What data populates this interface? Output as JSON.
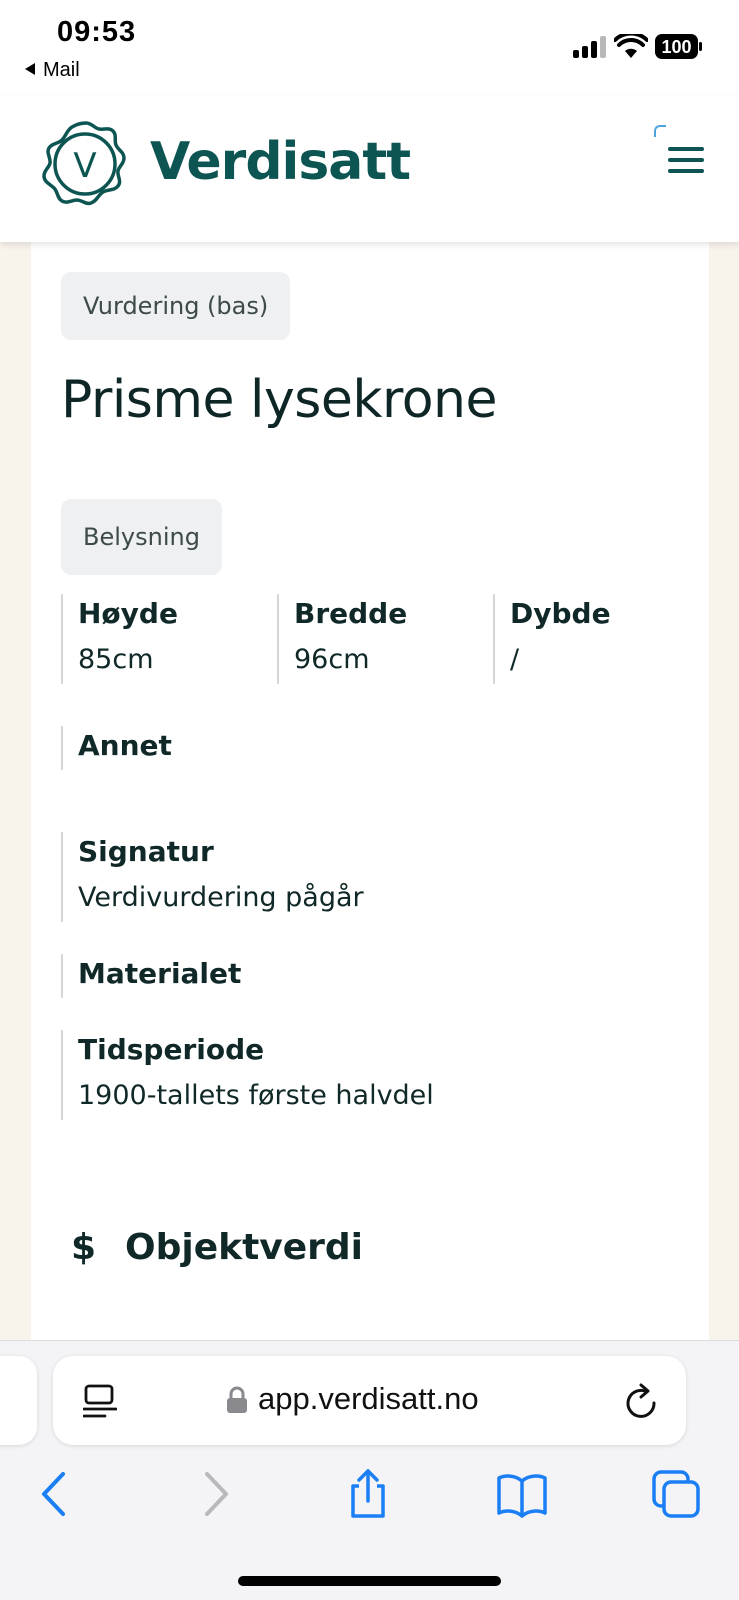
{
  "status_bar": {
    "time": "09:53",
    "back_app": "Mail",
    "battery_level": "100"
  },
  "header": {
    "brand": "Verdisatt",
    "logo_letter": "V",
    "brand_color": "#0d5552"
  },
  "item": {
    "type_chip": "Vurdering (bas)",
    "title": "Prisme lysekrone",
    "category_chip": "Belysning",
    "dimensions": [
      {
        "label": "Høyde",
        "value": "85cm"
      },
      {
        "label": "Bredde",
        "value": "96cm"
      },
      {
        "label": "Dybde",
        "value": "/"
      }
    ],
    "other": {
      "label": "Annet",
      "value": ""
    },
    "signature": {
      "label": "Signatur",
      "value": "Verdivurdering pågår"
    },
    "material": {
      "label": "Materialet",
      "value": ""
    },
    "period": {
      "label": "Tidsperiode",
      "value": "1900-tallets første halvdel"
    },
    "value_section": {
      "icon": "$",
      "heading": "Objektverdi"
    }
  },
  "browser": {
    "url": "app.verdisatt.no",
    "accent_color": "#1a7ef5"
  }
}
